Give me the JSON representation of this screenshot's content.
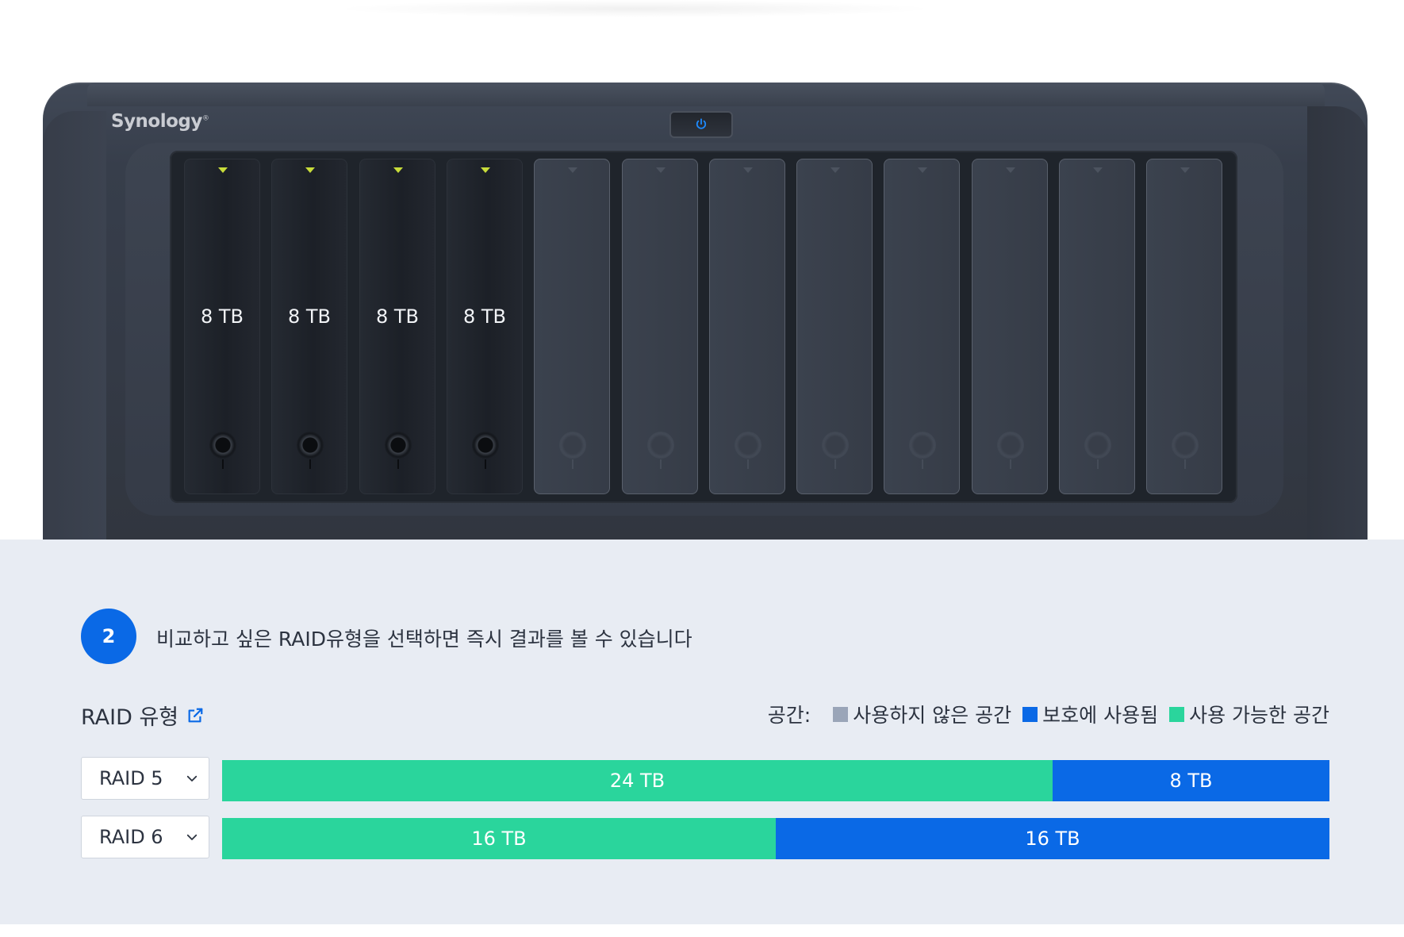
{
  "device": {
    "brand": "Synology",
    "brand_mark": "®",
    "bays_total": 12,
    "drives": [
      {
        "label": "8 TB",
        "installed": true
      },
      {
        "label": "8 TB",
        "installed": true
      },
      {
        "label": "8 TB",
        "installed": true
      },
      {
        "label": "8 TB",
        "installed": true
      },
      {
        "label": "",
        "installed": false
      },
      {
        "label": "",
        "installed": false
      },
      {
        "label": "",
        "installed": false
      },
      {
        "label": "",
        "installed": false
      },
      {
        "label": "",
        "installed": false
      },
      {
        "label": "",
        "installed": false
      },
      {
        "label": "",
        "installed": false
      },
      {
        "label": "",
        "installed": false
      }
    ],
    "led_color": "#c8dc3a",
    "power_icon": "power-icon"
  },
  "step": {
    "number": "2",
    "text": "비교하고 싶은 RAID유형을 선택하면 즉시 결과를 볼 수 있습니다"
  },
  "raid_section": {
    "title": "RAID 유형",
    "link_icon": "external-link-icon"
  },
  "legend": {
    "label": "공간:",
    "items": [
      {
        "label": "사용하지 않은 공간",
        "color": "#9aa5b8"
      },
      {
        "label": "보호에 사용됨",
        "color": "#0a69e6"
      },
      {
        "label": "사용 가능한 공간",
        "color": "#2ad59c"
      }
    ]
  },
  "rows": [
    {
      "select_value": "RAID 5",
      "segments": [
        {
          "label": "24 TB",
          "value_tb": 24,
          "type": "available",
          "color": "#2ad59c"
        },
        {
          "label": "8 TB",
          "value_tb": 8,
          "type": "protection",
          "color": "#0a69e6"
        }
      ]
    },
    {
      "select_value": "RAID 6",
      "segments": [
        {
          "label": "16 TB",
          "value_tb": 16,
          "type": "available",
          "color": "#2ad59c"
        },
        {
          "label": "16 TB",
          "value_tb": 16,
          "type": "protection",
          "color": "#0a69e6"
        }
      ]
    }
  ],
  "colors": {
    "accent": "#0a69e6",
    "panel_bg": "#e8ecf3",
    "text": "#2c3340"
  }
}
